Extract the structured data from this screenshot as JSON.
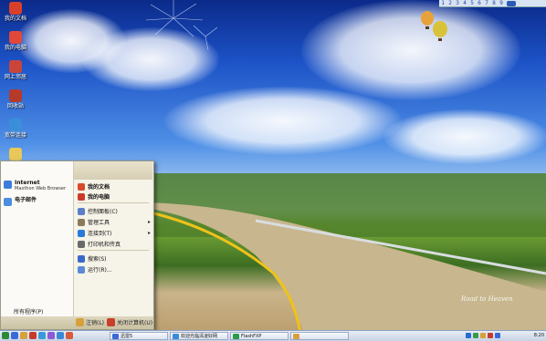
{
  "desktop_icons": [
    {
      "label": "我的文档",
      "icon": "my-documents-icon",
      "color": "#d9402a"
    },
    {
      "label": "我的电脑",
      "icon": "my-computer-icon",
      "color": "#e0483a"
    },
    {
      "label": "网上邻居",
      "icon": "network-icon",
      "color": "#c9453a"
    },
    {
      "label": "回收站",
      "icon": "recycle-bin-icon",
      "color": "#b53a2a"
    },
    {
      "label": "宽带连接",
      "icon": "broadband-connection-icon",
      "color": "#3a8fd8"
    }
  ],
  "topbar": {
    "numbers": [
      "1",
      "2",
      "3",
      "4",
      "5",
      "6",
      "7",
      "8",
      "9"
    ],
    "accent": "#2244aa"
  },
  "start_menu": {
    "pinned": [
      {
        "title": "Internet",
        "subtitle": "Maxthon Web Browser",
        "icon": "maxthon-icon",
        "color": "#3a7ed8"
      },
      {
        "title": "电子邮件",
        "subtitle": "",
        "icon": "email-icon",
        "color": "#4a8ee0"
      }
    ],
    "all_programs": "所有程序(P)",
    "right_items": [
      {
        "label": "我的文档",
        "icon": "my-documents-icon",
        "color": "#d84a2a",
        "bold": true,
        "arrow": false
      },
      {
        "label": "我的电脑",
        "icon": "my-computer-icon",
        "color": "#cc3a2a",
        "bold": true,
        "arrow": false
      },
      {
        "label": "控制面板(C)",
        "icon": "control-panel-icon",
        "color": "#5a7fc8",
        "bold": false,
        "arrow": false
      },
      {
        "label": "管理工具",
        "icon": "admin-tools-icon",
        "color": "#8a7a5a",
        "bold": false,
        "arrow": true
      },
      {
        "label": "连接到(T)",
        "icon": "connect-to-icon",
        "color": "#2a7ad8",
        "bold": false,
        "arrow": true
      },
      {
        "label": "打印机和传真",
        "icon": "printer-icon",
        "color": "#6a6a6a",
        "bold": false,
        "arrow": false
      },
      {
        "label": "搜索(S)",
        "icon": "search-icon",
        "color": "#3a6ac8",
        "bold": false,
        "arrow": false
      },
      {
        "label": "运行(R)...",
        "icon": "run-icon",
        "color": "#5a8ad8",
        "bold": false,
        "arrow": false
      }
    ],
    "logoff_label": "注销(L)",
    "shutdown_label": "关闭计算机(U)"
  },
  "taskbar": {
    "tasks": [
      {
        "label": "迅雷5",
        "icon": "thunder-icon",
        "color": "#3a6ad8"
      },
      {
        "label": "欢迎光临清凌好网",
        "icon": "browser-icon",
        "color": "#3a8ad8"
      },
      {
        "label": "FlashFXP",
        "icon": "flashfxp-icon",
        "color": "#2a9a4a"
      },
      {
        "label": "",
        "icon": "window-icon",
        "color": "#d8a03a"
      }
    ],
    "tray_icons": [
      {
        "icon": "qq-icon",
        "color": "#2a6ad8"
      },
      {
        "icon": "network-status-icon",
        "color": "#3a9a4a"
      },
      {
        "icon": "volume-icon",
        "color": "#d8a03a"
      },
      {
        "icon": "antivirus-icon",
        "color": "#c83a2a"
      },
      {
        "icon": "input-method-icon",
        "color": "#3a6ad8"
      }
    ],
    "clock": "8:20"
  },
  "wallpaper": {
    "watermark": "Road to Heaven"
  }
}
